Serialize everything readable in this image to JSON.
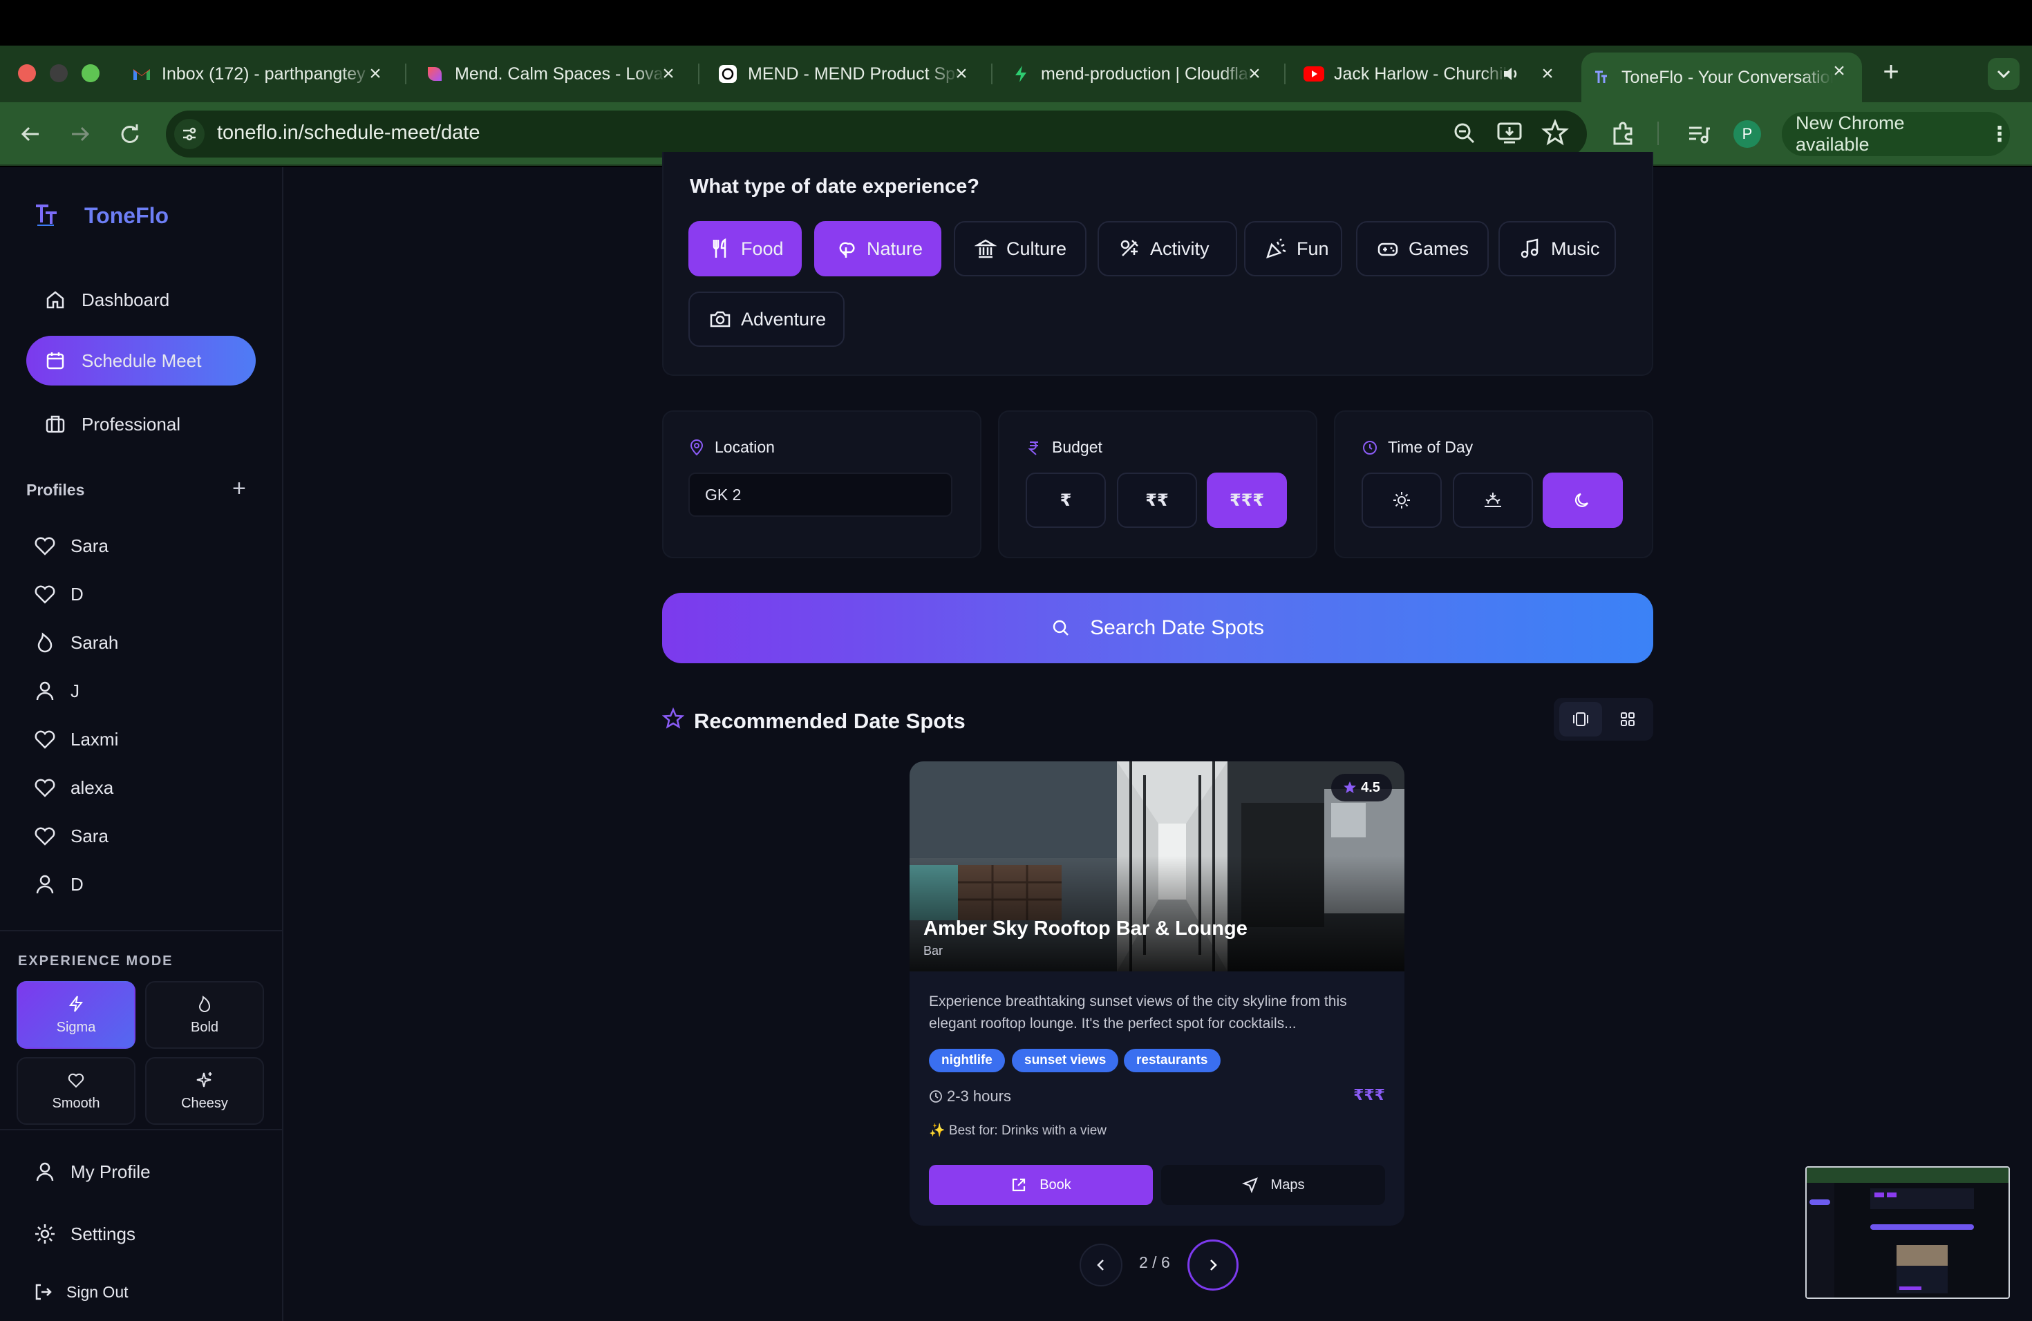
{
  "browser": {
    "tabs": [
      {
        "title": "Inbox (172) - parthpangtey",
        "icon": "gmail-icon"
      },
      {
        "title": "Mend. Calm Spaces - Lovable",
        "icon": "lovable-icon"
      },
      {
        "title": "MEND - MEND Product Spec",
        "icon": "chatgpt-icon"
      },
      {
        "title": "mend-production | Cloudflare",
        "icon": "bolt-icon"
      },
      {
        "title": "Jack Harlow - Churchill Downs",
        "icon": "youtube-icon"
      },
      {
        "title": "ToneFlo - Your Conversation",
        "icon": "toneflo-icon"
      }
    ],
    "url": "toneflo.in/schedule-meet/date",
    "new_chrome": "New Chrome available",
    "profile_initial": "P"
  },
  "sidebar": {
    "brand": "ToneFlo",
    "nav": [
      {
        "label": "Dashboard",
        "icon": "home-icon"
      },
      {
        "label": "Schedule Meet",
        "icon": "calendar-icon"
      },
      {
        "label": "Professional",
        "icon": "briefcase-icon"
      }
    ],
    "profiles_heading": "Profiles",
    "profiles": [
      {
        "name": "Sara",
        "icon": "heart-icon"
      },
      {
        "name": "D",
        "icon": "heart-icon"
      },
      {
        "name": "Sarah",
        "icon": "flame-icon"
      },
      {
        "name": "J",
        "icon": "user-icon"
      },
      {
        "name": "Laxmi",
        "icon": "heart-icon"
      },
      {
        "name": "alexa",
        "icon": "heart-icon"
      },
      {
        "name": "Sara",
        "icon": "heart-icon"
      },
      {
        "name": "D",
        "icon": "user-icon"
      }
    ],
    "experience_heading": "EXPERIENCE MODE",
    "modes": [
      {
        "label": "Sigma",
        "icon": "bolt-icon"
      },
      {
        "label": "Bold",
        "icon": "flame-icon"
      },
      {
        "label": "Smooth",
        "icon": "heart-icon"
      },
      {
        "label": "Cheesy",
        "icon": "sparkles-icon"
      }
    ],
    "footer": [
      {
        "label": "My Profile",
        "icon": "user-icon"
      },
      {
        "label": "Settings",
        "icon": "gear-icon"
      },
      {
        "label": "Sign Out",
        "icon": "logout-icon"
      }
    ]
  },
  "main": {
    "question": "What type of date experience?",
    "chips": [
      {
        "label": "Food",
        "icon": "utensils-icon",
        "selected": true
      },
      {
        "label": "Nature",
        "icon": "tree-icon",
        "selected": true
      },
      {
        "label": "Culture",
        "icon": "landmark-icon",
        "selected": false
      },
      {
        "label": "Activity",
        "icon": "activity-icon",
        "selected": false
      },
      {
        "label": "Fun",
        "icon": "party-icon",
        "selected": false
      },
      {
        "label": "Games",
        "icon": "gamepad-icon",
        "selected": false
      },
      {
        "label": "Music",
        "icon": "music-icon",
        "selected": false
      },
      {
        "label": "Adventure",
        "icon": "camera-icon",
        "selected": false
      }
    ],
    "location": {
      "label": "Location",
      "value": "GK 2"
    },
    "budget": {
      "label": "Budget",
      "options": [
        "₹",
        "₹₹",
        "₹₹₹"
      ],
      "selected": "₹₹₹"
    },
    "time": {
      "label": "Time of Day",
      "options": [
        "sun-icon",
        "sunset-icon",
        "moon-icon"
      ],
      "selected": "moon-icon"
    },
    "search_button": "Search Date Spots",
    "recommended_title": "Recommended Date Spots",
    "card": {
      "name": "Amber Sky Rooftop Bar & Lounge",
      "category": "Bar",
      "rating": "4.5",
      "description": "Experience breathtaking sunset views of the city skyline from this elegant rooftop lounge. It's the perfect spot for cocktails...",
      "tags": [
        "nightlife",
        "sunset views",
        "restaurants"
      ],
      "duration": "2-3 hours",
      "price": "₹₹₹",
      "best_for": "✨ Best for: Drinks with a view",
      "book": "Book",
      "maps": "Maps"
    },
    "pagination": "2 / 6"
  },
  "colors": {
    "accent": "#8b3cf0",
    "accent_blue": "#4f7cf5",
    "background": "#0c0e18",
    "browser_green": "#2a5a2e"
  }
}
